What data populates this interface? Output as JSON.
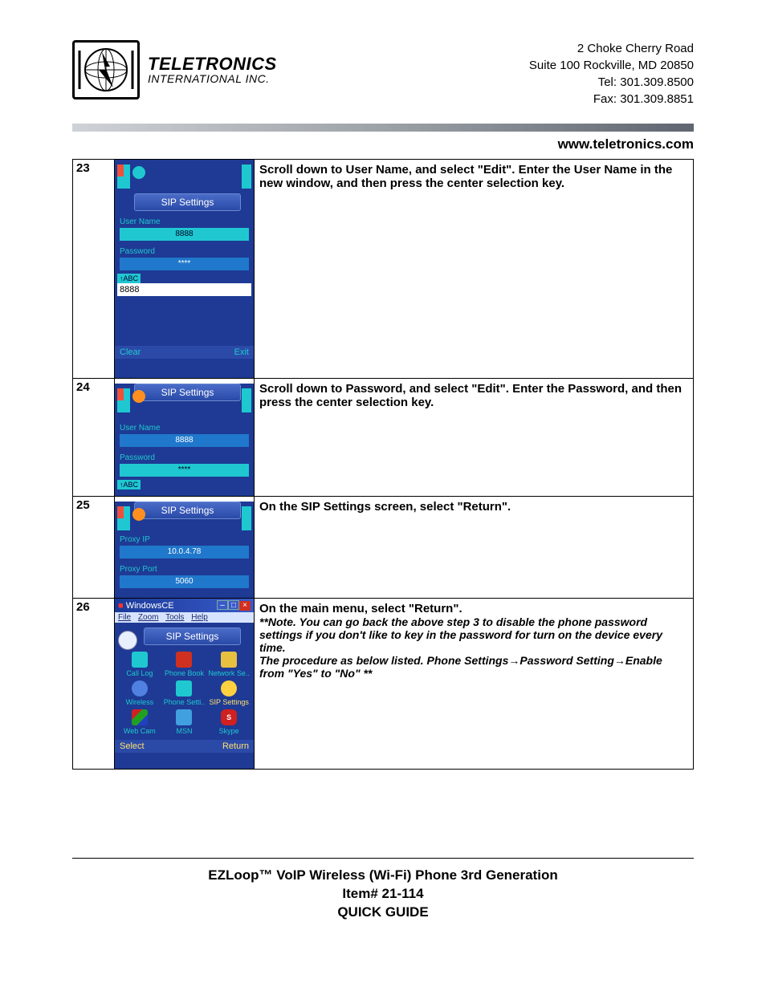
{
  "header": {
    "company_line1": "TELETRONICS",
    "company_line2": "INTERNATIONAL INC.",
    "addr1": "2 Choke Cherry Road",
    "addr2": "Suite 100  Rockville, MD 20850",
    "tel": "Tel: 301.309.8500",
    "fax": "Fax: 301.309.8851",
    "url": "www.teletronics.com"
  },
  "rows": {
    "r23": {
      "num": "23",
      "desc": "Scroll down to User Name, and select \"Edit\". Enter the User Name in the new window, and then press the center selection key.",
      "shot": {
        "title": "SIP Settings",
        "label1": "User Name",
        "field1": "8888",
        "label2": "Password",
        "field2": "****",
        "mode": "↑ABC",
        "textbox": "8888",
        "soft_left": "Clear",
        "soft_right": "Exit"
      }
    },
    "r24": {
      "num": "24",
      "desc": "Scroll down to Password, and select \"Edit\". Enter the Password, and then press the center selection key.",
      "shot": {
        "title": "SIP Settings",
        "label1": "User Name",
        "field1": "8888",
        "label2": "Password",
        "field2": "****",
        "mode": "↑ABC"
      }
    },
    "r25": {
      "num": "25",
      "desc": "On the SIP Settings screen, select \"Return\".",
      "shot": {
        "title": "SIP Settings",
        "label1": "Proxy IP",
        "field1": "10.0.4.78",
        "label2": "Proxy Port",
        "field2": "5060"
      }
    },
    "r26": {
      "num": "26",
      "desc_bold": "On the main menu, select \"Return\".",
      "note_l1": "**Note. You can go back the above step 3 to disable the phone password settings if you don't like to key in the password for turn on the device every time.",
      "note_l2_pre": "The procedure as below listed. Phone Settings",
      "note_l2_mid1": "Password Setting",
      "note_l2_mid2": "Enable from \"Yes\" to \"No\" **",
      "shot": {
        "win_title": "WindowsCE",
        "menu_file": "File",
        "menu_zoom": "Zoom",
        "menu_tools": "Tools",
        "menu_help": "Help",
        "app_title": "SIP Settings",
        "icons": {
          "i1": "Call Log",
          "i2": "Phone Book",
          "i3": "Network Se..",
          "i4": "Wireless",
          "i5": "Phone Setti..",
          "i6": "SIP Settings",
          "i7": "Web Cam",
          "i8": "MSN",
          "i9": "Skype"
        },
        "soft_left": "Select",
        "soft_right": "Return"
      }
    }
  },
  "footer": {
    "l1": "EZLoop™ VoIP Wireless (Wi-Fi) Phone 3rd Generation",
    "l2": "Item# 21-114",
    "l3": "QUICK GUIDE"
  }
}
